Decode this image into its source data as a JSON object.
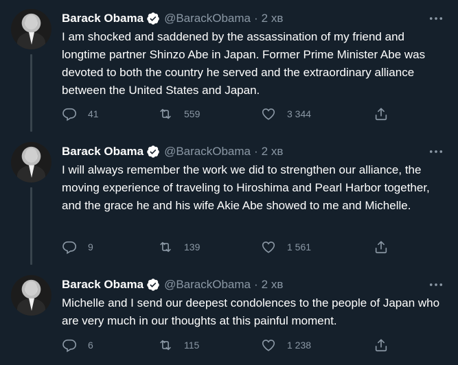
{
  "colors": {
    "background": "#15202b",
    "text": "#ffffff",
    "muted": "#8b98a5",
    "thread_line": "#38444d",
    "verified": "#ffffff"
  },
  "tweets": [
    {
      "author": "Barack Obama",
      "handle": "@BarackObama",
      "separator": "·",
      "time": "2 хв",
      "text": "I am shocked and saddened by the assassination of my friend and longtime partner Shinzo Abe in Japan. Former Prime Minister Abe was devoted to both the country he served and the extraordinary alliance between the United States and Japan.",
      "replies": "41",
      "retweets": "559",
      "likes": "3 344"
    },
    {
      "author": "Barack Obama",
      "handle": "@BarackObama",
      "separator": "·",
      "time": "2 хв",
      "text": "I will always remember the work we did to strengthen our alliance, the moving experience of traveling to Hiroshima and Pearl Harbor together, and the grace he and his wife Akie Abe showed to me and Michelle.",
      "replies": "9",
      "retweets": "139",
      "likes": "1 561"
    },
    {
      "author": "Barack Obama",
      "handle": "@BarackObama",
      "separator": "·",
      "time": "2 хв",
      "text": "Michelle and I send our deepest condolences to the people of Japan who are very much in our thoughts at this painful moment.",
      "replies": "6",
      "retweets": "115",
      "likes": "1 238"
    }
  ]
}
